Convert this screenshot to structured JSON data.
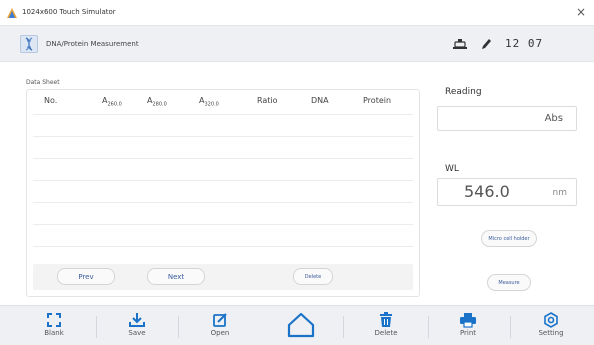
{
  "window": {
    "title": "1024x600 Touch Simulator",
    "close_glyph": "×"
  },
  "header": {
    "mode_label": "DNA/Protein Measurement",
    "time": "12  07",
    "mode_icon": "dna-icon",
    "icons": [
      "microscope-icon",
      "pen-icon"
    ]
  },
  "data_sheet": {
    "label": "Data Sheet",
    "columns": [
      {
        "text": "No.",
        "sub": ""
      },
      {
        "text": "A",
        "sub": "260.0"
      },
      {
        "text": "A",
        "sub": "280.0"
      },
      {
        "text": "A",
        "sub": "320.0"
      },
      {
        "text": "Ratio",
        "sub": ""
      },
      {
        "text": "DNA",
        "sub": ""
      },
      {
        "text": "Protein",
        "sub": ""
      }
    ],
    "buttons": {
      "prev": "Prev",
      "next": "Next",
      "delete": "Delete"
    }
  },
  "reading": {
    "label": "Reading",
    "unit": "Abs"
  },
  "wl": {
    "label": "WL",
    "value": "546.0",
    "unit": "nm"
  },
  "actions": {
    "micro_cell_holder": "Micro cell holder",
    "measure": "Measure"
  },
  "toolbar": {
    "blank": "Blank",
    "save": "Save",
    "open": "Open",
    "delete": "Delete",
    "print": "Print",
    "setting": "Setting"
  },
  "colors": {
    "accent": "#1a73c8",
    "header_bg": "#eef0f4",
    "button_text": "#3a5a9a"
  }
}
